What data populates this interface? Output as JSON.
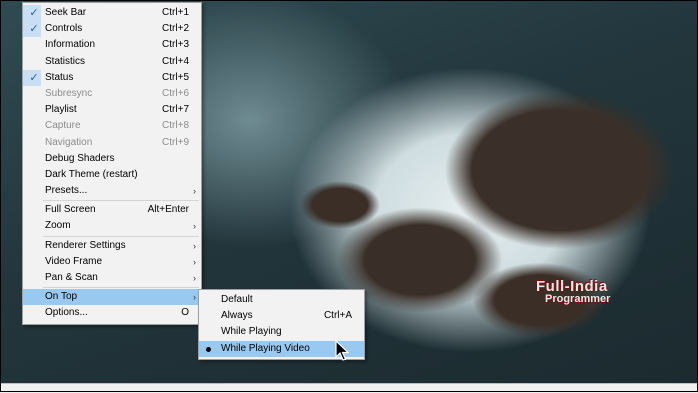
{
  "main_menu": [
    {
      "label": "Seek Bar",
      "shortcut": "Ctrl+1",
      "checked": true,
      "disabled": false,
      "submenu": false
    },
    {
      "label": "Controls",
      "shortcut": "Ctrl+2",
      "checked": true,
      "disabled": false,
      "submenu": false
    },
    {
      "label": "Information",
      "shortcut": "Ctrl+3",
      "checked": false,
      "disabled": false,
      "submenu": false
    },
    {
      "label": "Statistics",
      "shortcut": "Ctrl+4",
      "checked": false,
      "disabled": false,
      "submenu": false
    },
    {
      "label": "Status",
      "shortcut": "Ctrl+5",
      "checked": true,
      "disabled": false,
      "submenu": false
    },
    {
      "label": "Subresync",
      "shortcut": "Ctrl+6",
      "checked": false,
      "disabled": true,
      "submenu": false
    },
    {
      "label": "Playlist",
      "shortcut": "Ctrl+7",
      "checked": false,
      "disabled": false,
      "submenu": false
    },
    {
      "label": "Capture",
      "shortcut": "Ctrl+8",
      "checked": false,
      "disabled": true,
      "submenu": false
    },
    {
      "label": "Navigation",
      "shortcut": "Ctrl+9",
      "checked": false,
      "disabled": true,
      "submenu": false
    },
    {
      "label": "Debug Shaders",
      "shortcut": "",
      "checked": false,
      "disabled": false,
      "submenu": false
    },
    {
      "label": "Dark Theme (restart)",
      "shortcut": "",
      "checked": false,
      "disabled": false,
      "submenu": false
    },
    {
      "label": "Presets...",
      "shortcut": "",
      "checked": false,
      "disabled": false,
      "submenu": true
    },
    {
      "separator": true
    },
    {
      "label": "Full Screen",
      "shortcut": "Alt+Enter",
      "checked": false,
      "disabled": false,
      "submenu": false
    },
    {
      "label": "Zoom",
      "shortcut": "",
      "checked": false,
      "disabled": false,
      "submenu": true
    },
    {
      "separator": true
    },
    {
      "label": "Renderer Settings",
      "shortcut": "",
      "checked": false,
      "disabled": false,
      "submenu": true
    },
    {
      "label": "Video Frame",
      "shortcut": "",
      "checked": false,
      "disabled": false,
      "submenu": true
    },
    {
      "label": "Pan & Scan",
      "shortcut": "",
      "checked": false,
      "disabled": false,
      "submenu": true
    },
    {
      "separator": true
    },
    {
      "label": "On Top",
      "shortcut": "",
      "checked": false,
      "disabled": false,
      "submenu": true,
      "highlighted": true
    },
    {
      "label": "Options...",
      "shortcut": "O",
      "checked": false,
      "disabled": false,
      "submenu": false
    }
  ],
  "on_top_submenu": [
    {
      "label": "Default",
      "shortcut": "",
      "selected": false
    },
    {
      "label": "Always",
      "shortcut": "Ctrl+A",
      "selected": false
    },
    {
      "label": "While Playing",
      "shortcut": "",
      "selected": false
    },
    {
      "label": "While Playing Video",
      "shortcut": "",
      "selected": true,
      "highlighted": true
    }
  ],
  "icons": {
    "check": "checkmark-icon",
    "submenu": "chevron-right-icon",
    "radio": "radio-dot-icon"
  },
  "watermark": {
    "line1": "Full-India",
    "line2": "Programmer"
  },
  "colors": {
    "highlight": "#99c9ef",
    "check": "#2b5aa6",
    "menu_bg": "#f2f2f2"
  }
}
